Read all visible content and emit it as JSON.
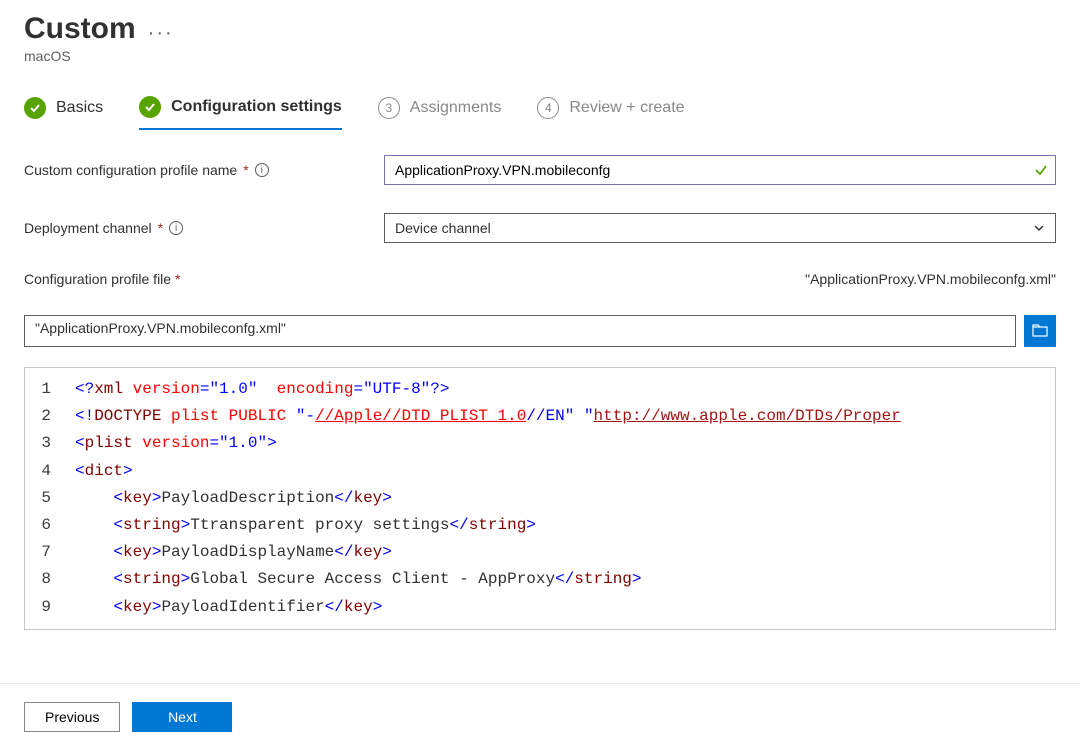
{
  "header": {
    "title": "Custom",
    "subtitle": "macOS"
  },
  "steps": [
    {
      "label": "Basics",
      "state": "done"
    },
    {
      "label": "Configuration settings",
      "state": "active"
    },
    {
      "label": "Assignments",
      "state": "pending",
      "num": "3"
    },
    {
      "label": "Review + create",
      "state": "pending",
      "num": "4"
    }
  ],
  "form": {
    "profile_name_label": "Custom configuration profile name",
    "profile_name_value": "ApplicationProxy.VPN.mobileconfg",
    "deployment_label": "Deployment channel",
    "deployment_value": "Device channel",
    "config_file_label": "Configuration profile file",
    "config_file_name": "\"ApplicationProxy.VPN.mobileconfg.xml\"",
    "config_file_path": "\"ApplicationProxy.VPN.mobileconfg.xml\""
  },
  "code": {
    "lines": [
      {
        "n": "1",
        "html": "<span class='t-blue'>&lt;?</span><span class='t-brown'>xml</span> <span class='t-redattr'>version</span><span class='t-blue'>=\"1.0\"</span>&nbsp;&nbsp;<span class='t-redattr'>encoding</span><span class='t-blue'>=\"UTF-8\"?&gt;</span>"
      },
      {
        "n": "2",
        "html": "<span class='t-blue'>&lt;!</span><span class='t-brown'>DOCTYPE</span> <span class='t-redattr'>plist</span> <span class='t-redattr'>PUBLIC</span> <span class='t-blue'>\"-</span><span class='t-url'>//Apple//DTD PLIST 1.0</span><span class='t-blue'>//EN\"</span> <span class='t-blue'>\"</span><span class='t-urlred'>http://www.apple.com/DTDs/Proper</span>"
      },
      {
        "n": "3",
        "html": "<span class='t-blue'>&lt;</span><span class='t-brown'>plist</span> <span class='t-redattr'>version</span><span class='t-blue'>=\"1.0\"&gt;</span>"
      },
      {
        "n": "4",
        "html": "<span class='t-blue'>&lt;</span><span class='t-brown'>dict</span><span class='t-blue'>&gt;</span>"
      },
      {
        "n": "5",
        "html": "&nbsp;&nbsp;&nbsp;&nbsp;<span class='t-blue'>&lt;</span><span class='t-brown'>key</span><span class='t-blue'>&gt;</span>PayloadDescription<span class='t-blue'>&lt;/</span><span class='t-brown'>key</span><span class='t-blue'>&gt;</span>"
      },
      {
        "n": "6",
        "html": "&nbsp;&nbsp;&nbsp;&nbsp;<span class='t-blue'>&lt;</span><span class='t-brown'>string</span><span class='t-blue'>&gt;</span>Ttransparent proxy settings<span class='t-blue'>&lt;/</span><span class='t-brown'>string</span><span class='t-blue'>&gt;</span>"
      },
      {
        "n": "7",
        "html": "&nbsp;&nbsp;&nbsp;&nbsp;<span class='t-blue'>&lt;</span><span class='t-brown'>key</span><span class='t-blue'>&gt;</span>PayloadDisplayName<span class='t-blue'>&lt;/</span><span class='t-brown'>key</span><span class='t-blue'>&gt;</span>"
      },
      {
        "n": "8",
        "html": "&nbsp;&nbsp;&nbsp;&nbsp;<span class='t-blue'>&lt;</span><span class='t-brown'>string</span><span class='t-blue'>&gt;</span>Global Secure Access Client - AppProxy<span class='t-blue'>&lt;/</span><span class='t-brown'>string</span><span class='t-blue'>&gt;</span>"
      },
      {
        "n": "9",
        "html": "&nbsp;&nbsp;&nbsp;&nbsp;<span class='t-blue'>&lt;</span><span class='t-brown'>key</span><span class='t-blue'>&gt;</span>PayloadIdentifier<span class='t-blue'>&lt;/</span><span class='t-brown'>key</span><span class='t-blue'>&gt;</span>"
      }
    ]
  },
  "footer": {
    "prev": "Previous",
    "next": "Next"
  }
}
